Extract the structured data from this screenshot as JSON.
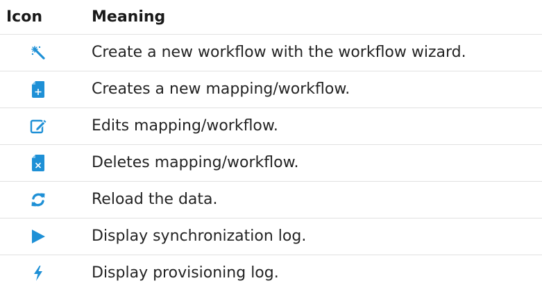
{
  "table": {
    "headers": {
      "icon": "Icon",
      "meaning": "Meaning"
    },
    "rows": [
      {
        "icon": "magic-wand-icon",
        "meaning": "Create a new workflow with the workflow wizard."
      },
      {
        "icon": "new-document-icon",
        "meaning": "Creates a new mapping/workflow."
      },
      {
        "icon": "edit-icon",
        "meaning": "Edits mapping/workflow."
      },
      {
        "icon": "delete-document-icon",
        "meaning": "Deletes mapping/workflow."
      },
      {
        "icon": "reload-icon",
        "meaning": "Reload the data."
      },
      {
        "icon": "play-icon",
        "meaning": "Display synchronization log."
      },
      {
        "icon": "lightning-icon",
        "meaning": "Display provisioning log."
      }
    ]
  },
  "colors": {
    "icon_blue": "#1e90d6",
    "divider": "#e1e1e1"
  }
}
